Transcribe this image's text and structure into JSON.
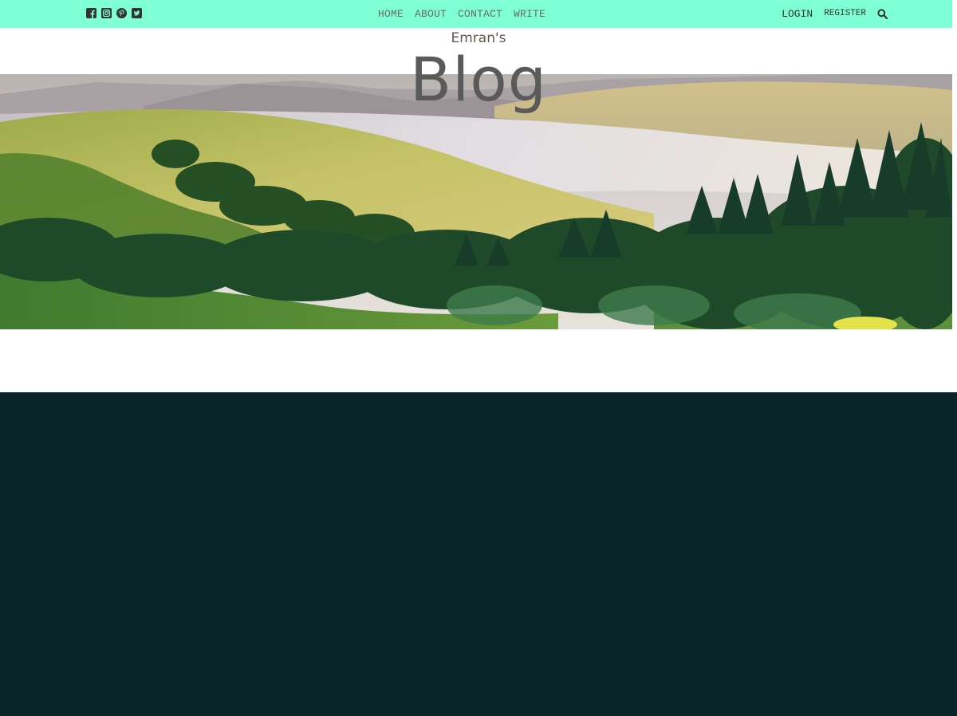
{
  "topbar": {
    "social_icons": [
      "facebook-square-icon",
      "instagram-icon",
      "pinterest-icon",
      "twitter-square-icon"
    ],
    "nav": {
      "home": "HOME",
      "about": "ABOUT",
      "contact": "CONTACT",
      "write": "WRITE"
    },
    "login": "LOGIN",
    "register": "REGISTER",
    "search_icon": "search-icon",
    "background_color": "#7fffd4"
  },
  "header": {
    "title_small": "Emran's",
    "title_large": "Blog"
  },
  "hero": {
    "image": "landscape-hills-forest"
  },
  "footer": {
    "background_color": "#0a252a"
  }
}
